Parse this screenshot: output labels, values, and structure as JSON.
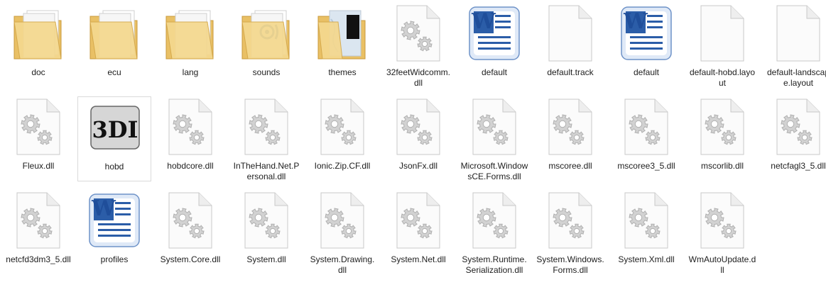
{
  "files": [
    {
      "name": "doc",
      "icon": "folder-icon"
    },
    {
      "name": "ecu",
      "icon": "folder-icon"
    },
    {
      "name": "lang",
      "icon": "folder-icon"
    },
    {
      "name": "sounds",
      "icon": "folder-sounds-icon"
    },
    {
      "name": "themes",
      "icon": "folder-themes-icon"
    },
    {
      "name": "32feetWidcomm.dll",
      "icon": "dll-gear-icon"
    },
    {
      "name": "default",
      "icon": "word-doc-icon"
    },
    {
      "name": "default.track",
      "icon": "blank-file-icon"
    },
    {
      "name": "default",
      "icon": "word-doc-icon"
    },
    {
      "name": "default-hobd.layout",
      "icon": "blank-file-icon"
    },
    {
      "name": "default-landscape.layout",
      "icon": "blank-file-icon"
    },
    {
      "name": "Fleux.dll",
      "icon": "dll-gear-icon"
    },
    {
      "name": "hobd",
      "icon": "hobd-app-icon"
    },
    {
      "name": "hobdcore.dll",
      "icon": "dll-gear-icon"
    },
    {
      "name": "InTheHand.Net.Personal.dll",
      "icon": "dll-gear-icon"
    },
    {
      "name": "Ionic.Zip.CF.dll",
      "icon": "dll-gear-icon"
    },
    {
      "name": "JsonFx.dll",
      "icon": "dll-gear-icon"
    },
    {
      "name": "Microsoft.WindowsCE.Forms.dll",
      "icon": "dll-gear-icon"
    },
    {
      "name": "mscoree.dll",
      "icon": "dll-gear-icon"
    },
    {
      "name": "mscoree3_5.dll",
      "icon": "dll-gear-icon"
    },
    {
      "name": "mscorlib.dll",
      "icon": "dll-gear-icon"
    },
    {
      "name": "netcfagl3_5.dll",
      "icon": "dll-gear-icon"
    },
    {
      "name": "netcfd3dm3_5.dll",
      "icon": "dll-gear-icon"
    },
    {
      "name": "profiles",
      "icon": "word-doc-icon"
    },
    {
      "name": "System.Core.dll",
      "icon": "dll-gear-icon"
    },
    {
      "name": "System.dll",
      "icon": "dll-gear-icon"
    },
    {
      "name": "System.Drawing.dll",
      "icon": "dll-gear-icon"
    },
    {
      "name": "System.Net.dll",
      "icon": "dll-gear-icon"
    },
    {
      "name": "System.Runtime.Serialization.dll",
      "icon": "dll-gear-icon"
    },
    {
      "name": "System.Windows.Forms.dll",
      "icon": "dll-gear-icon"
    },
    {
      "name": "System.Xml.dll",
      "icon": "dll-gear-icon"
    },
    {
      "name": "WmAutoUpdate.dll",
      "icon": "dll-gear-icon"
    }
  ],
  "hobd_icon_text": "3DI",
  "word_icon_letter": "W",
  "selected_index": 12
}
